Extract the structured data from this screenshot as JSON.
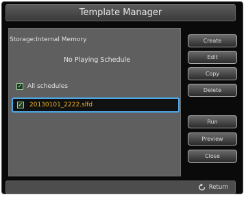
{
  "window": {
    "title": "Template Manager"
  },
  "panel": {
    "storage_text": "Storage:Internal Memory",
    "schedule_status": "No Playing Schedule",
    "all_schedules_label": "All schedules",
    "file_name": "20130101_2222.slfd"
  },
  "buttons": {
    "create": "Create",
    "edit": "Edit",
    "copy": "Copy",
    "delete": "Delete",
    "run": "Run",
    "preview": "Preview",
    "close": "Close"
  },
  "footer": {
    "return_label": "Return",
    "return_icon": "return-arrow-icon"
  },
  "colors": {
    "accent_border": "#4fa7e6",
    "file_text": "#f0b32a",
    "checkbox": "#9ed09e"
  }
}
